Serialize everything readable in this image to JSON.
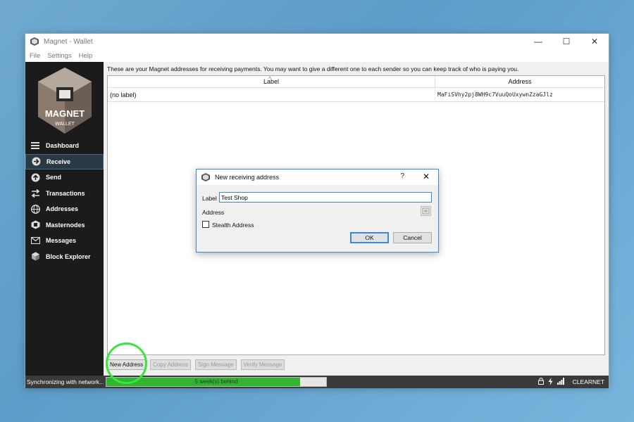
{
  "window": {
    "title": "Magnet - Wallet"
  },
  "menu": [
    "File",
    "Settings",
    "Help"
  ],
  "sidebar": {
    "logo_text": "MAGNET",
    "logo_subtext": "WALLET",
    "items": [
      {
        "label": "Dashboard",
        "icon": "menu-icon"
      },
      {
        "label": "Receive",
        "icon": "arrow-in-icon",
        "active": true
      },
      {
        "label": "Send",
        "icon": "arrow-up-icon"
      },
      {
        "label": "Transactions",
        "icon": "arrows-icon"
      },
      {
        "label": "Addresses",
        "icon": "globe-icon"
      },
      {
        "label": "Masternodes",
        "icon": "magnet-icon"
      },
      {
        "label": "Messages",
        "icon": "envelope-icon"
      },
      {
        "label": "Block Explorer",
        "icon": "cube-icon"
      }
    ]
  },
  "receive": {
    "intro": "These are your Magnet addresses for receiving payments. You may want to give a different one to each sender so you can keep track of who is paying you.",
    "columns": {
      "label": "Label",
      "address": "Address"
    },
    "rows": [
      {
        "label": "(no label)",
        "address": "MaFiSVhy2pj8WH9c7VuuQoUxywnZzaGJlz"
      }
    ],
    "buttons": {
      "new_address": "New Address",
      "copy_address": "Copy Address",
      "sign_message": "Sign Message",
      "verify_message": "Verify Message"
    }
  },
  "dialog": {
    "title": "New receiving address",
    "help": "?",
    "label_caption": "Label",
    "label_value": "Test Shop",
    "address_caption": "Address",
    "stealth_caption": "Stealth Address",
    "stealth_checked": false,
    "ok": "OK",
    "cancel": "Cancel"
  },
  "status": {
    "sync_text": "Synchronizing with network...",
    "progress_text": "5 week(s) behind",
    "progress": 0.88,
    "network": "CLEARNET"
  },
  "colors": {
    "accent": "#3c8ad6",
    "progress": "#2fb52f",
    "highlight": "#3ee43e",
    "sidebar": "#1b1b1b"
  }
}
